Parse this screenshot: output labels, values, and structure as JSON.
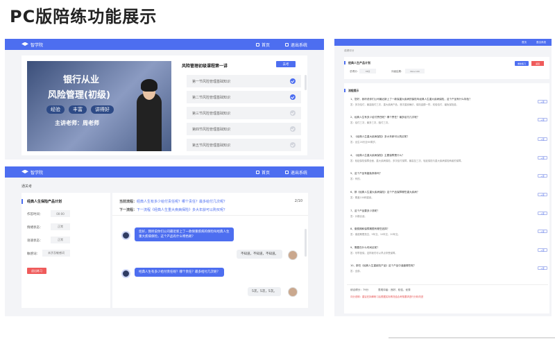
{
  "title": "PC版陪练功能展示",
  "app": {
    "name": "智学院",
    "nav_home": "首页",
    "nav_exit": "退出系统"
  },
  "course": {
    "video_text_1": "银行从业",
    "video_text_2": "风险管理(初级)",
    "video_tags": [
      "经验",
      "丰富",
      "讲得好"
    ],
    "video_teacher": "主讲老师：周老师",
    "title": "风险管理初级课程第一讲",
    "action_label": "去考",
    "lessons": [
      {
        "label": "第一节风险管理基础知识",
        "done": true
      },
      {
        "label": "第二节风险管理基础知识",
        "done": true
      },
      {
        "label": "第三节风险管理基础知识",
        "done": false
      },
      {
        "label": "第四节风险管理基础知识",
        "done": false
      },
      {
        "label": "第五节风险管理基础知识",
        "done": false
      }
    ]
  },
  "practice": {
    "breadcrumb": "通关考",
    "task_title": "经典人生保险产品计划",
    "fields": [
      {
        "label": "作答时间：",
        "value": "00:00"
      },
      {
        "label": "情绪状态：",
        "value": "正常"
      },
      {
        "label": "语速状态：",
        "value": "正常"
      },
      {
        "label": "敏感词：",
        "value": "未涉及敏感词"
      }
    ],
    "exit_label": "退出练习",
    "current_label": "当前流程：",
    "current_text": "经典人生有多少给付责任呢？哪个责任？最多给付几次呢？",
    "progress": "2/10",
    "next_label": "下一流程：",
    "next_text": "下一流程《经典人生重大疾病保险》多大年龄可以购买呢？",
    "messages": [
      {
        "side": "bot",
        "text": "您好，我听说你们公司最近新上了一款保重疾病的保险叫经典人生重大疾病保险，这个产品有什么特色呢？"
      },
      {
        "side": "user",
        "text": "不知道，不知道，不知道。"
      },
      {
        "side": "bot",
        "text": "经典人生有多少给付责任呢？哪个责任？最多给付几次呢？"
      },
      {
        "side": "user",
        "text": "5次，5次，5次。"
      }
    ]
  },
  "report": {
    "breadcrumb": "成绩评分",
    "task_title": "经典人生产品计划",
    "score_label": "总得分：",
    "score_value": "78分",
    "rating_label": "评级结果：",
    "rating_value": "Nice 100",
    "btn_retry": "重新练习",
    "btn_back": "返回",
    "section": "流程提示",
    "items": [
      {
        "q": "1、您好，我听说你们公司最近新上了一款保重大疾病的保险叫经典人生重大疾病保险，这个产品有什么特色？",
        "a": "答：多次给付，最高赔付三次，重大疾病产品，首次重疾确诊，保险金额一样，双倍给付，豁免保险费。"
      },
      {
        "q": "2、经典人生有多少给付责任呢？哪个责任？最多给付几次呢？",
        "a": "答：给付三次，最多三次，赔付三次。"
      },
      {
        "q": "3、《经典人生重大疾病保险》多大年龄可以购买呢？",
        "a": "答：出生28天至60周岁。"
      },
      {
        "q": "4、《经典人生重大疾病保险》主要保障是什么？",
        "a": "答：轻症保险保障全面，重大疾病保险，多次给付保障，最高至三次，轻症保险与重大疾病保险两者的保障。"
      },
      {
        "q": "5、这个产品有豁免条款吗？",
        "a": "答：有的。"
      },
      {
        "q": "6、那《经典人生重大疾病保险》这个产品保障哪些重大疾病？",
        "a": "答：覆盖100种重疾。"
      },
      {
        "q": "7、这个产品要多少钱呢？",
        "a": "答：价格合适。"
      },
      {
        "q": "8、缴费期和保障期限有哪些选择？",
        "a": "答：缴费期限趸交、5年交、10年交、20年交。"
      },
      {
        "q": "9、需要在什么时间买呢？",
        "a": "答：尽早投保，这样我们可以早点享受保障。"
      },
      {
        "q": "10、那在《经典人生重疾险产品》这个产品中涵盖哪些呢？",
        "a": "答：全部。"
      }
    ],
    "item_btn": "+查",
    "footer_score_label": "综合得分：",
    "footer_score_value": "79分",
    "footer_level_label": "表现评级：",
    "footer_level_value": "良好、较佳、优秀",
    "footer_note": "评分说明：建议在拆解练习后根据实际情况结合考核要求进行分析改进"
  }
}
